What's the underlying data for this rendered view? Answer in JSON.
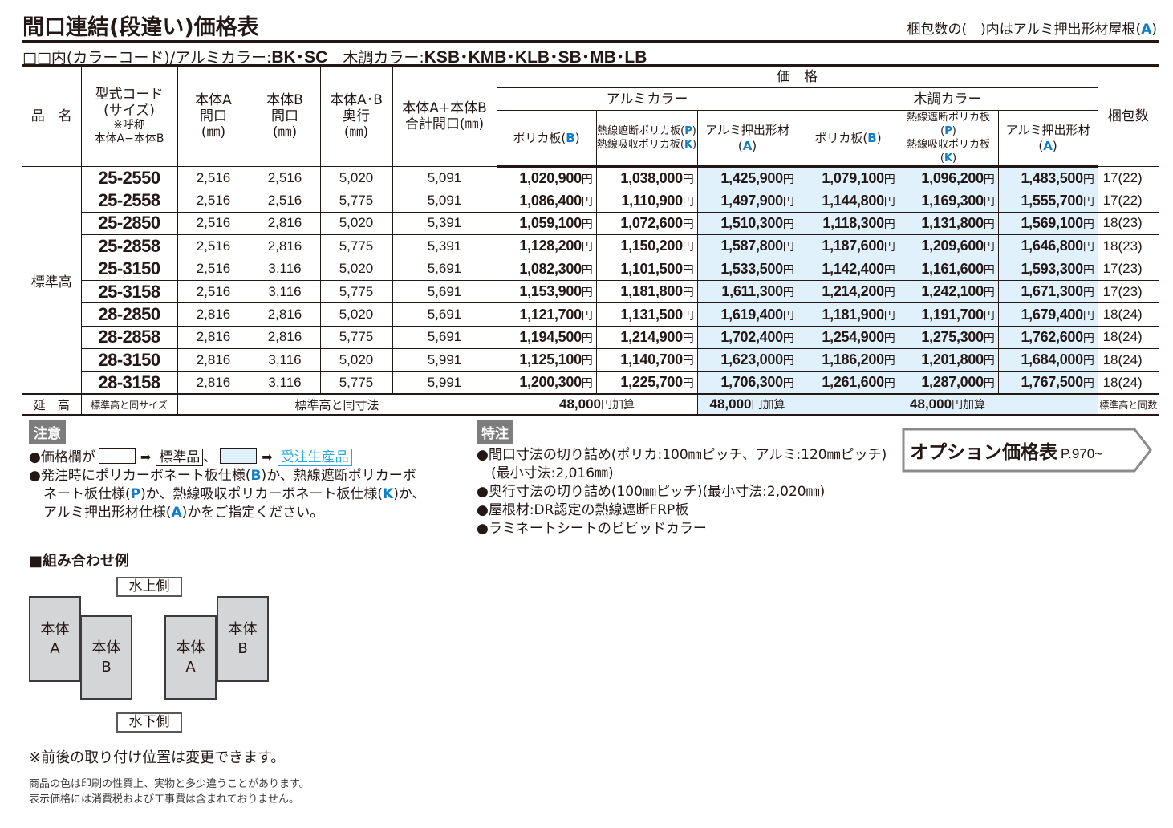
{
  "header": {
    "title": "間口連結(段違い)価格表",
    "package_note_prefix": "梱包数の(　)内はアルミ押出形材屋根(",
    "package_note_letter": "A",
    "package_note_suffix": ")",
    "color_line_prefix": "□□内(カラーコード)/アルミカラー:",
    "alumi_colors": "BK･SC",
    "wood_label": "　木調カラー:",
    "wood_colors": "KSB･KMB･KLB･SB･MB･LB"
  },
  "table": {
    "headers": {
      "product_name": "品　名",
      "model_code_1": "型式コード",
      "model_code_2": "(サイズ)",
      "model_code_3": "※呼称",
      "model_code_4": "本体A−本体B",
      "a_width_1": "本体A",
      "a_width_2": "間口",
      "a_width_3": "(㎜)",
      "b_width_1": "本体B",
      "b_width_2": "間口",
      "b_width_3": "(㎜)",
      "depth_1": "本体A･B",
      "depth_2": "奥行",
      "depth_3": "(㎜)",
      "total_1": "本体A+本体B",
      "total_2": "合計間口(㎜)",
      "price": "価　格",
      "alumi_color": "アルミカラー",
      "wood_color": "木調カラー",
      "package_count": "梱包数",
      "poly": "ポリカ板(",
      "poly_letter": "B",
      "heat_1": "熱線遮断ポリカ板(",
      "heat_1_letter": "P",
      "heat_2": "熱線吸収ポリカ板(",
      "heat_2_letter": "K",
      "alumi_ext": "アルミ押出形材(",
      "alumi_ext_letter": "A",
      "close_paren": ")"
    },
    "group_label": "標準高",
    "yen": "円",
    "rows": [
      {
        "code": "25-2550",
        "a": "2,516",
        "b": "2,516",
        "depth": "5,020",
        "total": "5,091",
        "al_b": "1,020,900",
        "al_pk": "1,038,000",
        "al_a": "1,425,900",
        "wd_b": "1,079,100",
        "wd_pk": "1,096,200",
        "wd_a": "1,483,500",
        "pkg": "17(22)"
      },
      {
        "code": "25-2558",
        "a": "2,516",
        "b": "2,516",
        "depth": "5,775",
        "total": "5,091",
        "al_b": "1,086,400",
        "al_pk": "1,110,900",
        "al_a": "1,497,900",
        "wd_b": "1,144,800",
        "wd_pk": "1,169,300",
        "wd_a": "1,555,700",
        "pkg": "17(22)"
      },
      {
        "code": "25-2850",
        "a": "2,516",
        "b": "2,816",
        "depth": "5,020",
        "total": "5,391",
        "al_b": "1,059,100",
        "al_pk": "1,072,600",
        "al_a": "1,510,300",
        "wd_b": "1,118,300",
        "wd_pk": "1,131,800",
        "wd_a": "1,569,100",
        "pkg": "18(23)"
      },
      {
        "code": "25-2858",
        "a": "2,516",
        "b": "2,816",
        "depth": "5,775",
        "total": "5,391",
        "al_b": "1,128,200",
        "al_pk": "1,150,200",
        "al_a": "1,587,800",
        "wd_b": "1,187,600",
        "wd_pk": "1,209,600",
        "wd_a": "1,646,800",
        "pkg": "18(23)"
      },
      {
        "code": "25-3150",
        "a": "2,516",
        "b": "3,116",
        "depth": "5,020",
        "total": "5,691",
        "al_b": "1,082,300",
        "al_pk": "1,101,500",
        "al_a": "1,533,500",
        "wd_b": "1,142,400",
        "wd_pk": "1,161,600",
        "wd_a": "1,593,300",
        "pkg": "17(23)"
      },
      {
        "code": "25-3158",
        "a": "2,516",
        "b": "3,116",
        "depth": "5,775",
        "total": "5,691",
        "al_b": "1,153,900",
        "al_pk": "1,181,800",
        "al_a": "1,611,300",
        "wd_b": "1,214,200",
        "wd_pk": "1,242,100",
        "wd_a": "1,671,300",
        "pkg": "17(23)"
      },
      {
        "code": "28-2850",
        "a": "2,816",
        "b": "2,816",
        "depth": "5,020",
        "total": "5,691",
        "al_b": "1,121,700",
        "al_pk": "1,131,500",
        "al_a": "1,619,400",
        "wd_b": "1,181,900",
        "wd_pk": "1,191,700",
        "wd_a": "1,679,400",
        "pkg": "18(24)"
      },
      {
        "code": "28-2858",
        "a": "2,816",
        "b": "2,816",
        "depth": "5,775",
        "total": "5,691",
        "al_b": "1,194,500",
        "al_pk": "1,214,900",
        "al_a": "1,702,400",
        "wd_b": "1,254,900",
        "wd_pk": "1,275,300",
        "wd_a": "1,762,600",
        "pkg": "18(24)"
      },
      {
        "code": "28-3150",
        "a": "2,816",
        "b": "3,116",
        "depth": "5,020",
        "total": "5,991",
        "al_b": "1,125,100",
        "al_pk": "1,140,700",
        "al_a": "1,623,000",
        "wd_b": "1,186,200",
        "wd_pk": "1,201,800",
        "wd_a": "1,684,000",
        "pkg": "18(24)"
      },
      {
        "code": "28-3158",
        "a": "2,816",
        "b": "3,116",
        "depth": "5,775",
        "total": "5,991",
        "al_b": "1,200,300",
        "al_pk": "1,225,700",
        "al_a": "1,706,300",
        "wd_b": "1,261,600",
        "wd_pk": "1,287,000",
        "wd_a": "1,767,500",
        "pkg": "18(24)"
      }
    ],
    "extended": {
      "label": "延　高",
      "size": "標準高と同サイズ",
      "dims": "標準高と同寸法",
      "add_amount": "48,000",
      "add_suffix": "加算",
      "pkg": "標準高と同数"
    }
  },
  "caution": {
    "label": "注意",
    "line1_prefix": "●価格欄が",
    "arrow": "➡",
    "standard": "標準品",
    "sep": "、",
    "made_to_order": "受注生産品",
    "line2_a": "●発注時にポリカーボネート板仕様(",
    "line2_b": ")か、熱線遮断ポリカーボ",
    "line3_a": "ネート板仕様(",
    "line3_b": ")か、熱線吸収ポリカーボネート板仕様(",
    "line3_c": ")か、",
    "line4_a": "アルミ押出形材仕様(",
    "line4_b": ")かをご指定ください。",
    "letter_b": "B",
    "letter_p": "P",
    "letter_k": "K",
    "letter_a": "A"
  },
  "special": {
    "label": "特注",
    "items": [
      "●間口寸法の切り詰め(ポリカ:100㎜ピッチ、アルミ:120㎜ピッチ)",
      "(最小寸法:2,016㎜)",
      "●奥行寸法の切り詰め(100㎜ピッチ)(最小寸法:2,020㎜)",
      "●屋根材:DR認定の熱線遮断FRP板",
      "●ラミネートシートのビビッドカラー"
    ]
  },
  "option": {
    "label": "オプション価格表",
    "page": "P.970~"
  },
  "combination": {
    "title": "■組み合わせ例",
    "upper": "水上側",
    "lower": "水下側",
    "body_a_1": "本体",
    "body_a_2": "A",
    "body_b_1": "本体",
    "body_b_2": "B",
    "remark": "※前後の取り付け位置は変更できます。"
  },
  "footer": {
    "line1": "商品の色は印刷の性質上、実物と多少違うことがあります。",
    "line2": "表示価格には消費税および工事費は含まれておりません。"
  }
}
